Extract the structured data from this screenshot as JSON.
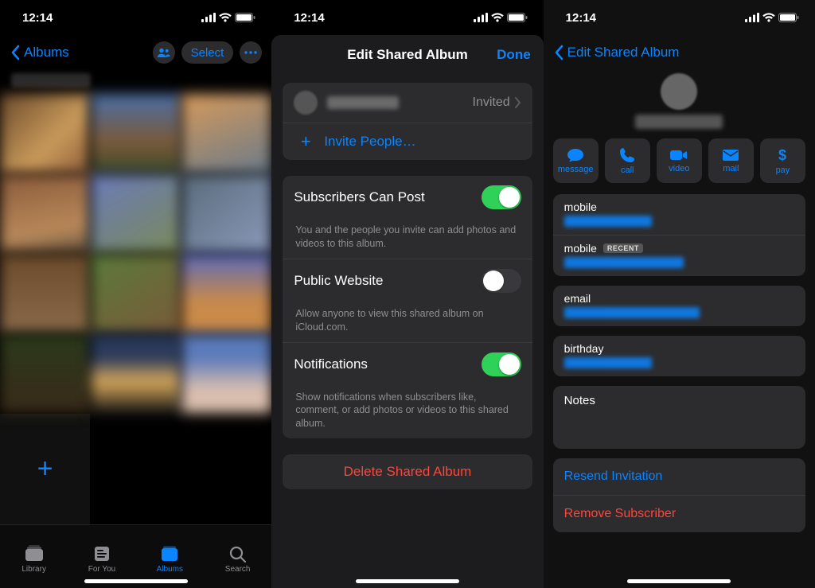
{
  "status": {
    "time": "12:14"
  },
  "screen1": {
    "back_label": "Albums",
    "select_label": "Select",
    "add_label": "+",
    "tabs": {
      "library": "Library",
      "for_you": "For You",
      "albums": "Albums",
      "search": "Search"
    }
  },
  "screen2": {
    "title": "Edit Shared Album",
    "done": "Done",
    "invited_status": "Invited",
    "invite_people": "Invite People…",
    "subscribers_title": "Subscribers Can Post",
    "subscribers_caption": "You and the people you invite can add photos and videos to this album.",
    "public_title": "Public Website",
    "public_caption": "Allow anyone to view this shared album on iCloud.com.",
    "notifications_title": "Notifications",
    "notifications_caption": "Show notifications when subscribers like, comment, or add photos or videos to this shared album.",
    "delete": "Delete Shared Album"
  },
  "screen3": {
    "back_label": "Edit Shared Album",
    "actions": {
      "message": "message",
      "call": "call",
      "video": "video",
      "mail": "mail",
      "pay": "pay"
    },
    "mobile_label": "mobile",
    "recent_badge": "RECENT",
    "email_label": "email",
    "birthday_label": "birthday",
    "notes_label": "Notes",
    "resend": "Resend Invitation",
    "remove": "Remove Subscriber"
  }
}
